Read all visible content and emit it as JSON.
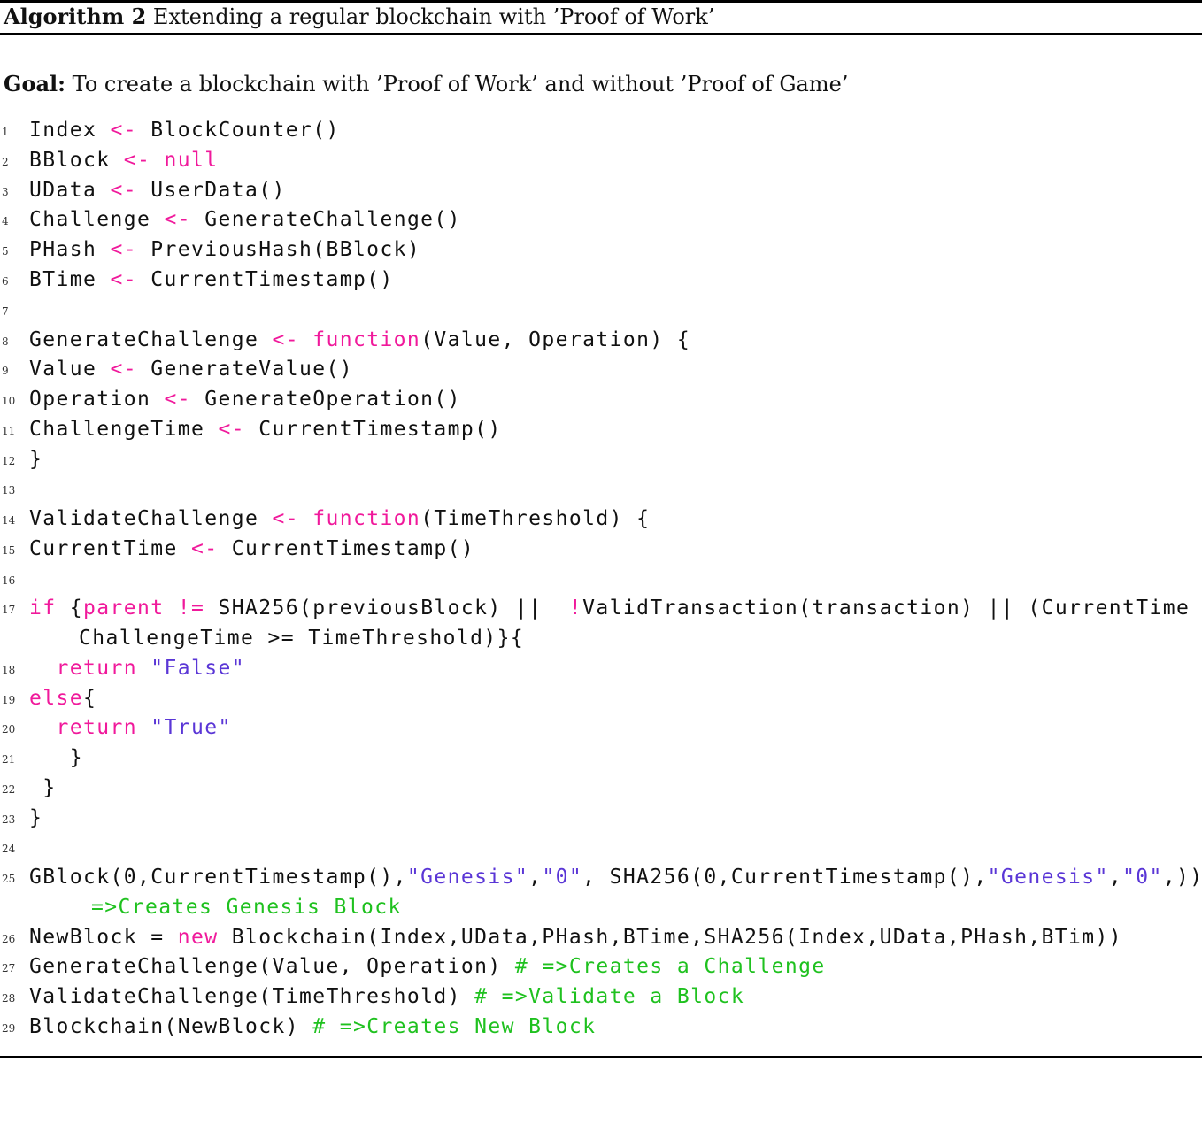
{
  "algorithm": {
    "label": "Algorithm 2",
    "title": "Extending a regular blockchain with ’Proof of Work’"
  },
  "goal": {
    "label": "Goal:",
    "text": "To create a blockchain with ’Proof of Work’ and without ’Proof of Game’"
  },
  "code": {
    "line_numbers": [
      "1",
      "2",
      "3",
      "4",
      "5",
      "6",
      "7",
      "8",
      "9",
      "10",
      "11",
      "12",
      "13",
      "14",
      "15",
      "16",
      "17",
      "18",
      "19",
      "20",
      "21",
      "22",
      "23",
      "24",
      "25",
      "26",
      "27",
      "28",
      "29"
    ],
    "l1": {
      "a": "Index ",
      "b": "<-",
      "c": " BlockCounter()"
    },
    "l2": {
      "a": "BBlock ",
      "b": "<-",
      "c": " ",
      "d": "null"
    },
    "l3": {
      "a": "UData ",
      "b": "<-",
      "c": " UserData()"
    },
    "l4": {
      "a": "Challenge ",
      "b": "<-",
      "c": " GenerateChallenge()"
    },
    "l5": {
      "a": "PHash ",
      "b": "<-",
      "c": " PreviousHash(BBlock)"
    },
    "l6": {
      "a": "BTime ",
      "b": "<-",
      "c": " CurrentTimestamp()"
    },
    "l8": {
      "a": "GenerateChallenge ",
      "b": "<-",
      "c": " ",
      "d": "function",
      "e": "(Value, Operation) {"
    },
    "l9": {
      "a": "Value ",
      "b": "<-",
      "c": " GenerateValue()"
    },
    "l10": {
      "a": "Operation ",
      "b": "<-",
      "c": " GenerateOperation()"
    },
    "l11": {
      "a": "ChallengeTime ",
      "b": "<-",
      "c": " CurrentTimestamp()"
    },
    "l12": {
      "a": "}"
    },
    "l14": {
      "a": "ValidateChallenge ",
      "b": "<-",
      "c": " ",
      "d": "function",
      "e": "(TimeThreshold) {"
    },
    "l15": {
      "a": "CurrentTime ",
      "b": "<-",
      "c": " CurrentTimestamp()"
    },
    "l17": {
      "a": "if",
      "b": " {",
      "c": "parent",
      "d": " ",
      "e": "!=",
      "f": " SHA256(previousBlock) ||  ",
      "g": "!",
      "h": "ValidTransaction(transaction) || (CurrentTime -"
    },
    "l17b": {
      "a": "ChallengeTime >= TimeThreshold)}{"
    },
    "l18": {
      "a": "  ",
      "b": "return",
      "c": " ",
      "d": "\"False\""
    },
    "l19": {
      "a": "else",
      "b": "{"
    },
    "l20": {
      "a": "  ",
      "b": "return",
      "c": " ",
      "d": "\"True\""
    },
    "l21": {
      "a": "   }"
    },
    "l22": {
      "a": " }"
    },
    "l23": {
      "a": "}"
    },
    "l25": {
      "a": "GBlock(0,CurrentTimestamp(),",
      "b": "\"Genesis\"",
      "c": ",",
      "d": "\"0\"",
      "e": ", SHA256(0,CurrentTimestamp(),",
      "f": "\"Genesis\"",
      "g": ",",
      "h": "\"0\"",
      "i": ",)) ",
      "j": "#"
    },
    "l25b": {
      "a": "=>Creates Genesis Block"
    },
    "l26": {
      "a": "NewBlock = ",
      "b": "new",
      "c": " Blockchain(Index,UData,PHash,BTime,SHA256(Index,UData,PHash,BTim))"
    },
    "l27": {
      "a": "GenerateChallenge(Value, Operation) ",
      "b": "# =>Creates a Challenge"
    },
    "l28": {
      "a": "ValidateChallenge(TimeThreshold) ",
      "b": "# =>Validate a Block"
    },
    "l29": {
      "a": "Blockchain(NewBlock) ",
      "b": "# =>Creates New Block"
    }
  },
  "colors": {
    "keyword": "#f0199b",
    "string": "#5a36d6",
    "comment": "#1fc11f"
  }
}
